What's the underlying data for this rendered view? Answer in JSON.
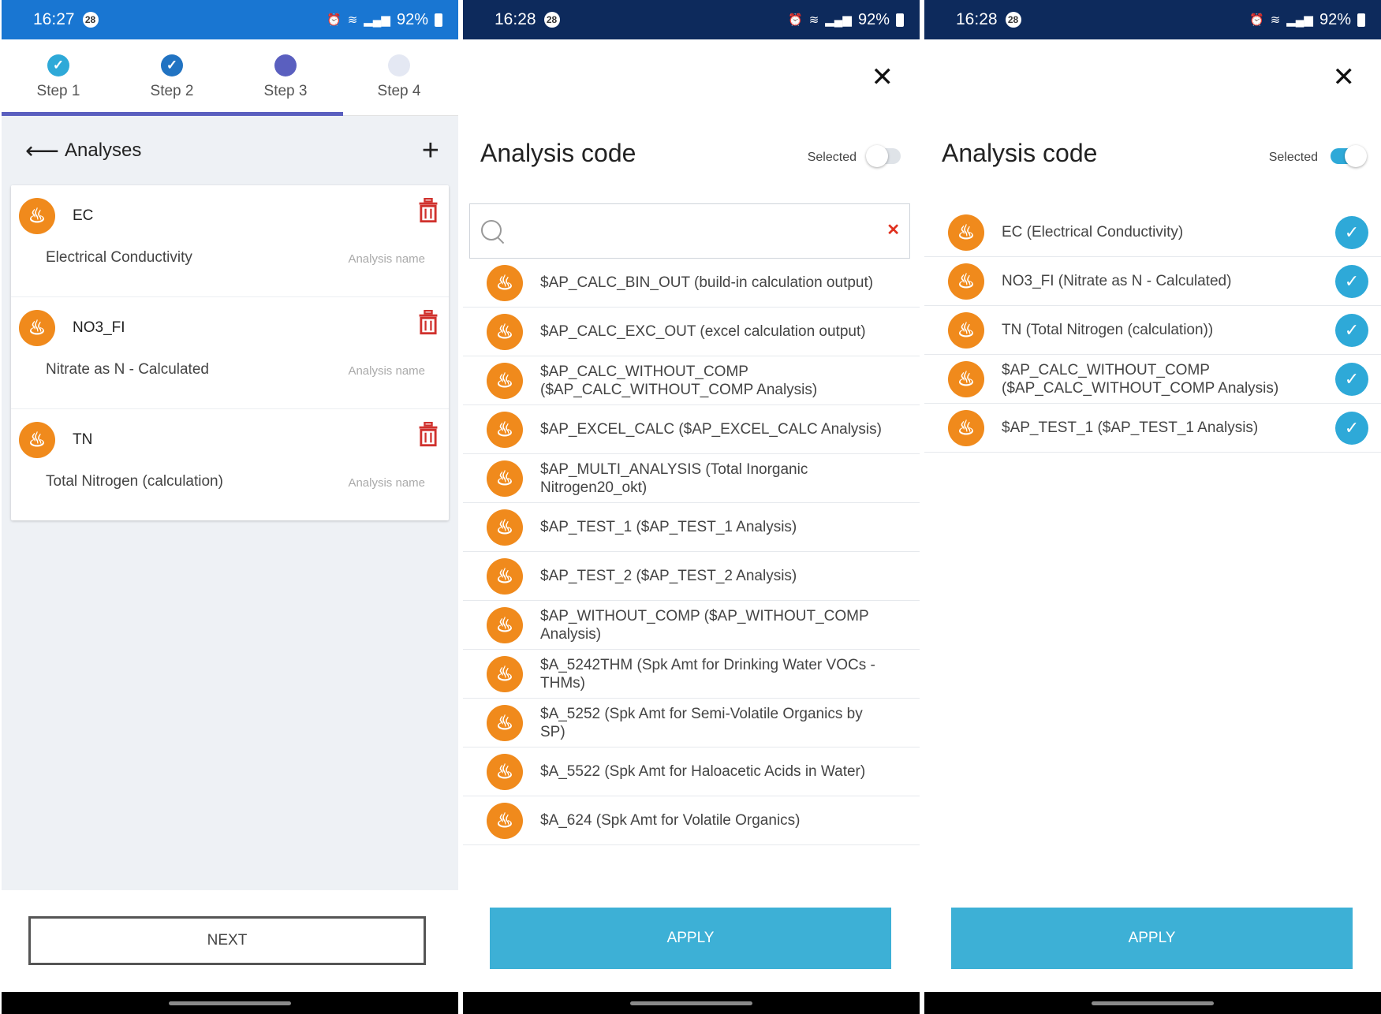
{
  "colors": {
    "accent": "#3db0d6",
    "brand_avatar": "#f08a1c",
    "step_active": "#5a5fbf",
    "delete": "#d0312d"
  },
  "phone1": {
    "status": {
      "time": "16:27",
      "badge": "28",
      "battery": "92%"
    },
    "steps": [
      {
        "label": "Step 1",
        "state": "done"
      },
      {
        "label": "Step 2",
        "state": "done"
      },
      {
        "label": "Step 3",
        "state": "active"
      },
      {
        "label": "Step 4",
        "state": "todo"
      }
    ],
    "header": {
      "title": "Analyses"
    },
    "analyses": [
      {
        "code": "EC",
        "name": "Electrical Conductivity",
        "hint": "Analysis name"
      },
      {
        "code": "NO3_FI",
        "name": "Nitrate as N - Calculated",
        "hint": "Analysis name"
      },
      {
        "code": "TN",
        "name": "Total Nitrogen (calculation)",
        "hint": "Analysis name"
      }
    ],
    "next_label": "NEXT"
  },
  "phone2": {
    "status": {
      "time": "16:28",
      "badge": "28",
      "battery": "92%"
    },
    "title": "Analysis code",
    "selected_label": "Selected",
    "selected_toggle": "off",
    "search": {
      "value": "",
      "placeholder": ""
    },
    "items": [
      "$AP_CALC_BIN_OUT (build-in calculation output)",
      "$AP_CALC_EXC_OUT (excel calculation output)",
      "$AP_CALC_WITHOUT_COMP ($AP_CALC_WITHOUT_COMP Analysis)",
      "$AP_EXCEL_CALC ($AP_EXCEL_CALC Analysis)",
      "$AP_MULTI_ANALYSIS (Total Inorganic Nitrogen20_okt)",
      "$AP_TEST_1 ($AP_TEST_1 Analysis)",
      "$AP_TEST_2 ($AP_TEST_2 Analysis)",
      "$AP_WITHOUT_COMP ($AP_WITHOUT_COMP Analysis)",
      "$A_5242THM (Spk Amt for Drinking Water VOCs - THMs)",
      "$A_5252 (Spk Amt for Semi-Volatile Organics by SP)",
      "$A_5522 (Spk Amt for Haloacetic Acids in Water)",
      "$A_624 (Spk Amt for Volatile Organics)"
    ],
    "apply_label": "APPLY"
  },
  "phone3": {
    "status": {
      "time": "16:28",
      "badge": "28",
      "battery": "92%"
    },
    "title": "Analysis code",
    "selected_label": "Selected",
    "selected_toggle": "on",
    "items": [
      "EC (Electrical Conductivity)",
      "NO3_FI (Nitrate as N - Calculated)",
      "TN (Total Nitrogen (calculation))",
      "$AP_CALC_WITHOUT_COMP ($AP_CALC_WITHOUT_COMP Analysis)",
      "$AP_TEST_1 ($AP_TEST_1 Analysis)"
    ],
    "apply_label": "APPLY"
  }
}
